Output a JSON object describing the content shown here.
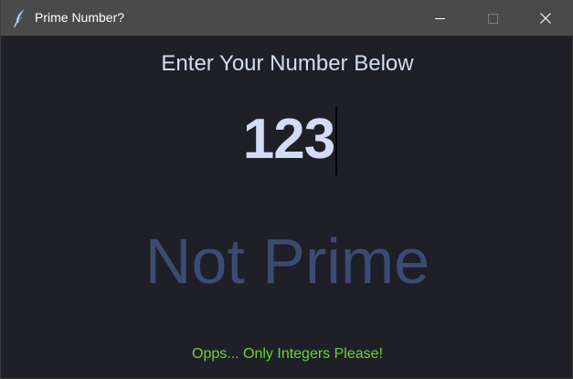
{
  "window": {
    "title": "Prime Number?",
    "icon": "feather-icon"
  },
  "controls": {
    "minimize_icon": "minimize-icon",
    "maximize_icon": "maximize-icon",
    "close_icon": "close-icon"
  },
  "main": {
    "prompt": "Enter Your Number Below",
    "input_value": "123",
    "result": "Not Prime",
    "status": "Opps... Only Integers Please!"
  },
  "colors": {
    "background": "#1f1f27",
    "titlebar": "#4a4a4a",
    "prompt_text": "#d3ddf0",
    "input_text": "#d2dcf5",
    "result_text": "#3b4c74",
    "status_text": "#6ad33a"
  }
}
